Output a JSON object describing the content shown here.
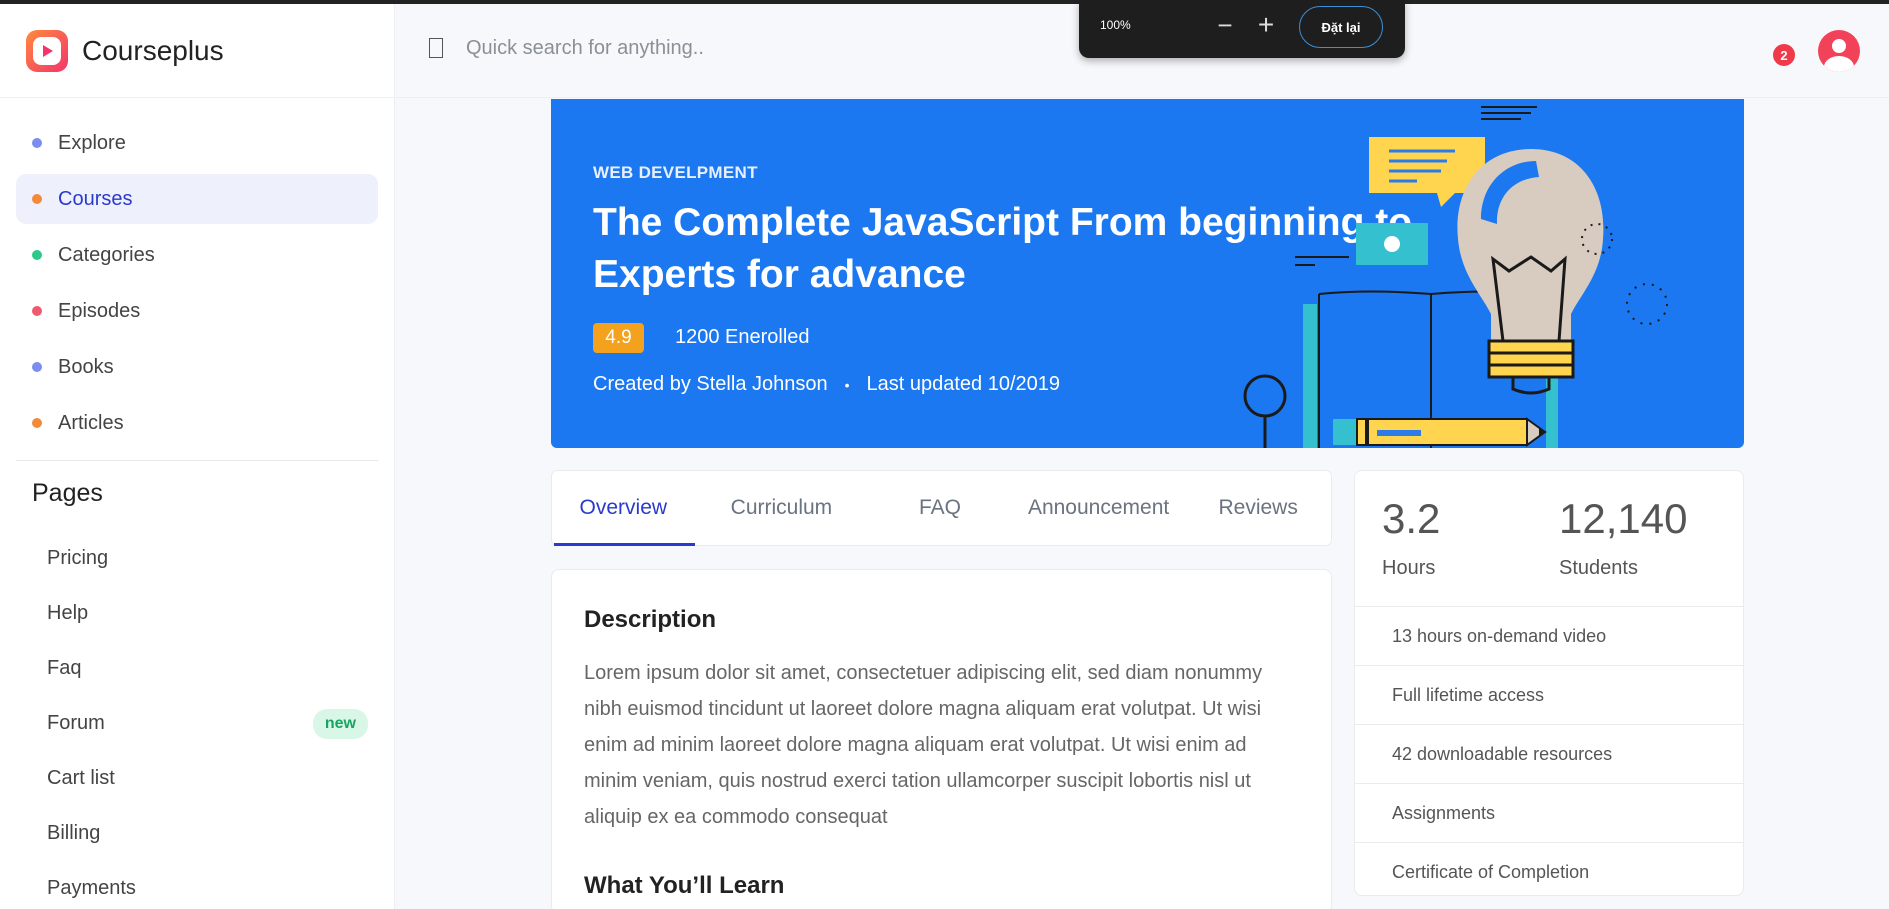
{
  "brand": {
    "name": "Courseplus",
    "accent": "#f3356b"
  },
  "search": {
    "placeholder": "Quick search for anything.."
  },
  "notifications": {
    "count": "2"
  },
  "zoom": {
    "level": "100%",
    "reset_label": "Đặt lại"
  },
  "sidebar": {
    "items": [
      {
        "label": "Explore",
        "dot_color": "#7b8df0",
        "active": false
      },
      {
        "label": "Courses",
        "dot_color": "#f28a3a",
        "active": true
      },
      {
        "label": "Categories",
        "dot_color": "#2ec98a",
        "active": false
      },
      {
        "label": "Episodes",
        "dot_color": "#f05a6e",
        "active": false
      },
      {
        "label": "Books",
        "dot_color": "#7b8df0",
        "active": false
      },
      {
        "label": "Articles",
        "dot_color": "#f28a3a",
        "active": false
      }
    ],
    "pages_title": "Pages",
    "pages": [
      {
        "label": "Pricing"
      },
      {
        "label": "Help"
      },
      {
        "label": "Faq"
      },
      {
        "label": "Forum",
        "badge": "new"
      },
      {
        "label": "Cart list"
      },
      {
        "label": "Billing"
      },
      {
        "label": "Payments"
      }
    ]
  },
  "hero": {
    "category": "WEB DEVELPMENT",
    "title": "The Complete JavaScript From beginning to Experts for advance",
    "rating": "4.9",
    "enrolled": "1200 Enerolled",
    "created_prefix": "Created by",
    "author": "Stella Johnson",
    "separator": "•",
    "updated": "Last updated 10/2019",
    "bg_color": "#1c78f0"
  },
  "tabs": [
    {
      "label": "Overview",
      "active": true
    },
    {
      "label": "Curriculum",
      "active": false
    },
    {
      "label": "FAQ",
      "active": false
    },
    {
      "label": "Announcement",
      "active": false
    },
    {
      "label": "Reviews",
      "active": false
    }
  ],
  "description": {
    "title": "Description",
    "body": "Lorem ipsum dolor sit amet, consectetuer adipiscing elit, sed diam nonummy nibh euismod tincidunt ut laoreet dolore magna aliquam erat volutpat. Ut wisi enim ad minim laoreet dolore magna aliquam erat volutpat. Ut wisi enim ad minim veniam, quis nostrud exerci tation ullamcorper suscipit lobortis nisl ut aliquip ex ea commodo consequat",
    "learn_title": "What You’ll Learn"
  },
  "stats": {
    "hours_value": "3.2",
    "hours_label": "Hours",
    "students_value": "12,140",
    "students_label": "Students",
    "features": [
      "13 hours on-demand video",
      "Full lifetime access",
      "42 downloadable resources",
      "Assignments",
      "Certificate of Completion"
    ]
  }
}
